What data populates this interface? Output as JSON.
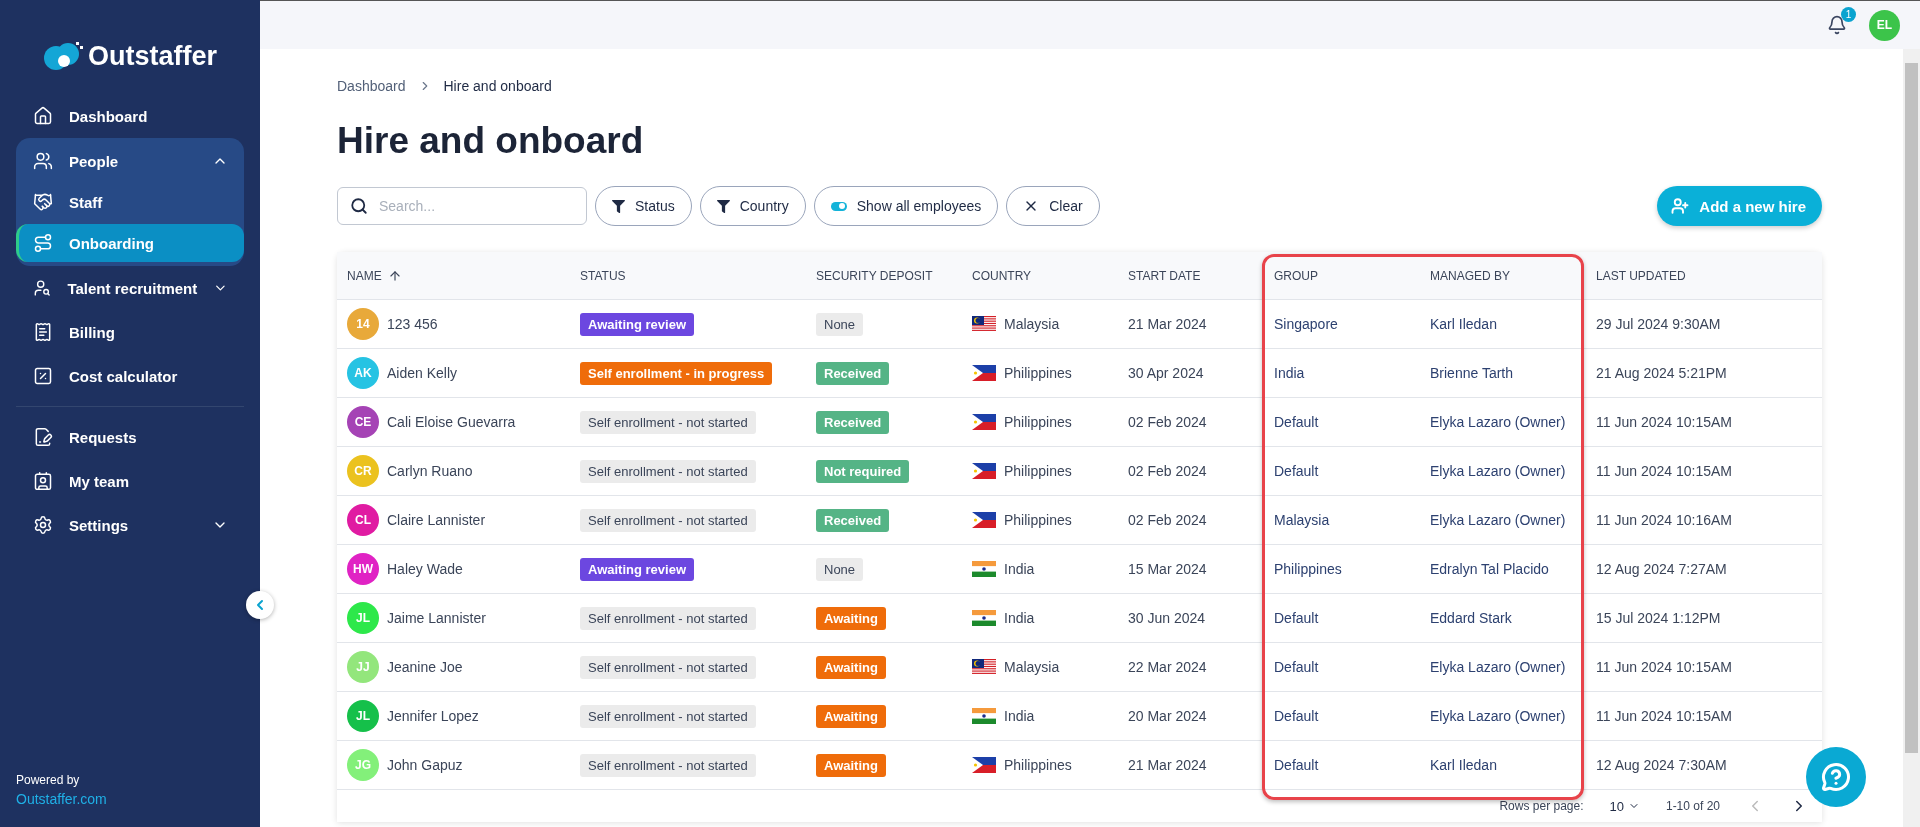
{
  "sidebar": {
    "logo": "Outstaffer",
    "items": [
      {
        "kind": "link",
        "label": "Dashboard",
        "selected": false
      },
      {
        "kind": "group",
        "label": "People",
        "expanded": true,
        "selected": false,
        "children": [
          {
            "label": "Staff",
            "selected": false
          },
          {
            "label": "Onboarding",
            "selected": true
          }
        ]
      },
      {
        "kind": "group",
        "label": "Talent recruitment",
        "expanded": false,
        "selected": false
      },
      {
        "kind": "link",
        "label": "Billing",
        "selected": false
      },
      {
        "kind": "link",
        "label": "Cost calculator",
        "selected": false
      },
      {
        "kind": "divider"
      },
      {
        "kind": "link",
        "label": "Requests",
        "selected": false
      },
      {
        "kind": "link",
        "label": "My team",
        "selected": false
      },
      {
        "kind": "group",
        "label": "Settings",
        "expanded": false,
        "selected": false
      }
    ],
    "footer": {
      "text": "Powered by",
      "link": "Outstaffer.com"
    }
  },
  "topbar": {
    "notification_count": "1",
    "avatar": "EL"
  },
  "breadcrumb": [
    "Dashboard",
    "Hire and onboard"
  ],
  "title": "Hire and onboard",
  "filters": {
    "search": {
      "placeholder": "Search..."
    },
    "buttons": [
      {
        "kind": "filter",
        "label": "Status"
      },
      {
        "kind": "filter",
        "label": "Country"
      },
      {
        "kind": "toggle",
        "label": "Show all employees",
        "on": true
      },
      {
        "kind": "clear",
        "label": "Clear"
      }
    ],
    "add_button": "Add a new hire"
  },
  "table": {
    "columns": [
      {
        "label": "NAME",
        "sorted": true,
        "highlighted": false
      },
      {
        "label": "STATUS",
        "sorted": false,
        "highlighted": false
      },
      {
        "label": "SECURITY DEPOSIT",
        "sorted": false,
        "highlighted": false
      },
      {
        "label": "COUNTRY",
        "sorted": false,
        "highlighted": false
      },
      {
        "label": "START DATE",
        "sorted": false,
        "highlighted": false
      },
      {
        "label": "GROUP",
        "sorted": false,
        "highlighted": true
      },
      {
        "label": "MANAGED BY",
        "sorted": false,
        "highlighted": true
      },
      {
        "label": "LAST UPDATED",
        "sorted": false,
        "highlighted": false
      }
    ],
    "rows": [
      {
        "initials": "14",
        "color": "#e8a93a",
        "name": "123 456",
        "status": {
          "label": "Awaiting review",
          "kind": "review"
        },
        "deposit": {
          "label": "None",
          "kind": "none"
        },
        "country": "Malaysia",
        "start": "21 Mar 2024",
        "group": "Singapore",
        "managed_by": "Karl Iledan",
        "updated": "29 Jul 2024 9:30AM"
      },
      {
        "initials": "AK",
        "color": "#26c3e3",
        "name": "Aiden Kelly",
        "status": {
          "label": "Self enrollment - in progress",
          "kind": "progress"
        },
        "deposit": {
          "label": "Received",
          "kind": "received"
        },
        "country": "Philippines",
        "start": "30 Apr 2024",
        "group": "India",
        "managed_by": "Brienne Tarth",
        "updated": "21 Aug 2024 5:21PM"
      },
      {
        "initials": "CE",
        "color": "#a543b5",
        "name": "Cali Eloise Guevarra",
        "status": {
          "label": "Self enrollment - not started",
          "kind": "not_started"
        },
        "deposit": {
          "label": "Received",
          "kind": "received"
        },
        "country": "Philippines",
        "start": "02 Feb 2024",
        "group": "Default",
        "managed_by": "Elyka Lazaro (Owner)",
        "updated": "11 Jun 2024 10:15AM"
      },
      {
        "initials": "CR",
        "color": "#ebc21f",
        "name": "Carlyn Ruano",
        "status": {
          "label": "Self enrollment - not started",
          "kind": "not_started"
        },
        "deposit": {
          "label": "Not required",
          "kind": "received"
        },
        "country": "Philippines",
        "start": "02 Feb 2024",
        "group": "Default",
        "managed_by": "Elyka Lazaro (Owner)",
        "updated": "11 Jun 2024 10:15AM"
      },
      {
        "initials": "CL",
        "color": "#e01ba2",
        "name": "Claire Lannister",
        "status": {
          "label": "Self enrollment - not started",
          "kind": "not_started"
        },
        "deposit": {
          "label": "Received",
          "kind": "received"
        },
        "country": "Philippines",
        "start": "02 Feb 2024",
        "group": "Malaysia",
        "managed_by": "Elyka Lazaro (Owner)",
        "updated": "11 Jun 2024 10:16AM"
      },
      {
        "initials": "HW",
        "color": "#e023c4",
        "name": "Haley Wade",
        "status": {
          "label": "Awaiting review",
          "kind": "review"
        },
        "deposit": {
          "label": "None",
          "kind": "none"
        },
        "country": "India",
        "start": "15 Mar 2024",
        "group": "Philippines",
        "managed_by": "Edralyn Tal Placido",
        "updated": "12 Aug 2024 7:27AM"
      },
      {
        "initials": "JL",
        "color": "#2de84a",
        "name": "Jaime Lannister",
        "status": {
          "label": "Self enrollment - not started",
          "kind": "not_started"
        },
        "deposit": {
          "label": "Awaiting",
          "kind": "awaiting"
        },
        "country": "India",
        "start": "30 Jun 2024",
        "group": "Default",
        "managed_by": "Eddard Stark",
        "updated": "15 Jul 2024 1:12PM"
      },
      {
        "initials": "JJ",
        "color": "#93e67c",
        "name": "Jeanine Joe",
        "status": {
          "label": "Self enrollment - not started",
          "kind": "not_started"
        },
        "deposit": {
          "label": "Awaiting",
          "kind": "awaiting"
        },
        "country": "Malaysia",
        "start": "22 Mar 2024",
        "group": "Default",
        "managed_by": "Elyka Lazaro (Owner)",
        "updated": "11 Jun 2024 10:15AM"
      },
      {
        "initials": "JL",
        "color": "#15c04a",
        "name": "Jennifer Lopez",
        "status": {
          "label": "Self enrollment - not started",
          "kind": "not_started"
        },
        "deposit": {
          "label": "Awaiting",
          "kind": "awaiting"
        },
        "country": "India",
        "start": "20 Mar 2024",
        "group": "Default",
        "managed_by": "Elyka Lazaro (Owner)",
        "updated": "11 Jun 2024 10:15AM"
      },
      {
        "initials": "JG",
        "color": "#83f07a",
        "name": "John Gapuz",
        "status": {
          "label": "Self enrollment - not started",
          "kind": "not_started"
        },
        "deposit": {
          "label": "Awaiting",
          "kind": "awaiting"
        },
        "country": "Philippines",
        "start": "21 Mar 2024",
        "group": "Default",
        "managed_by": "Karl Iledan",
        "updated": "12 Aug 2024 7:30AM"
      }
    ],
    "footer": {
      "rows_label": "Rows per page:",
      "rows_value": "10",
      "range": "1-10 of 20"
    }
  }
}
